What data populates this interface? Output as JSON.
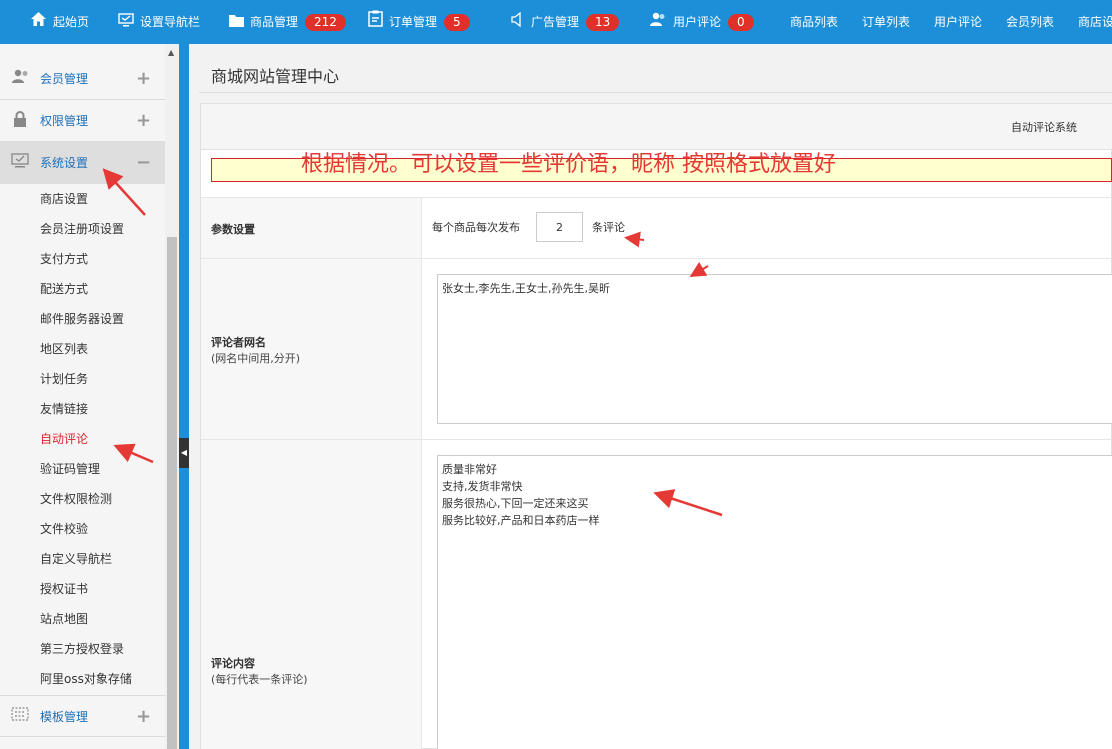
{
  "topnav": {
    "items": [
      {
        "label": "起始页",
        "icon": "home-icon"
      },
      {
        "label": "设置导航栏",
        "icon": "monitor-icon"
      },
      {
        "label": "商品管理",
        "icon": "folder-icon",
        "badge": "212"
      },
      {
        "label": "订单管理",
        "icon": "clipboard-icon",
        "badge": "5"
      },
      {
        "label": "广告管理",
        "icon": "speaker-icon",
        "badge": "13"
      },
      {
        "label": "用户评论",
        "icon": "users-icon",
        "badge": "0"
      },
      {
        "label": "商品列表"
      },
      {
        "label": "订单列表"
      },
      {
        "label": "用户评论"
      },
      {
        "label": "会员列表"
      },
      {
        "label": "商店设"
      }
    ]
  },
  "sidebar": {
    "groups": [
      {
        "label": "会员管理",
        "icon": "users-icon",
        "toggle": "+"
      },
      {
        "label": "权限管理",
        "icon": "lock-icon",
        "toggle": "+"
      },
      {
        "label": "系统设置",
        "icon": "monitor-check-icon",
        "toggle": "−"
      },
      {
        "label": "模板管理",
        "icon": "template-icon",
        "toggle": "+"
      }
    ],
    "system_items": [
      "商店设置",
      "会员注册项设置",
      "支付方式",
      "配送方式",
      "邮件服务器设置",
      "地区列表",
      "计划任务",
      "友情链接",
      "自动评论",
      "验证码管理",
      "文件权限检测",
      "文件校验",
      "自定义导航栏",
      "授权证书",
      "站点地图",
      "第三方授权登录",
      "阿里oss对象存储"
    ]
  },
  "main": {
    "title": "商城网站管理中心",
    "panel_head": "自动评论系统",
    "notice": "根据情况。可以设置一些评价语，昵称 按照格式放置好",
    "param": {
      "label": "参数设置",
      "prefix": "每个商品每次发布",
      "value": "2",
      "suffix": "条评论"
    },
    "names": {
      "label": "评论者网名",
      "hint": "(网名中间用,分开)",
      "value": "张女士,李先生,王女士,孙先生,吴昕"
    },
    "content": {
      "label": "评论内容",
      "hint": "(每行代表一条评论)",
      "value": "质量非常好\n支持,发货非常快\n服务很热心,下回一定还来这买\n服务比较好,产品和日本药店一样"
    }
  },
  "colors": {
    "nav_blue": "#1d8fd9",
    "badge_red": "#e0302a",
    "annotation_red": "#e53935",
    "active_link": "#d9232b"
  }
}
